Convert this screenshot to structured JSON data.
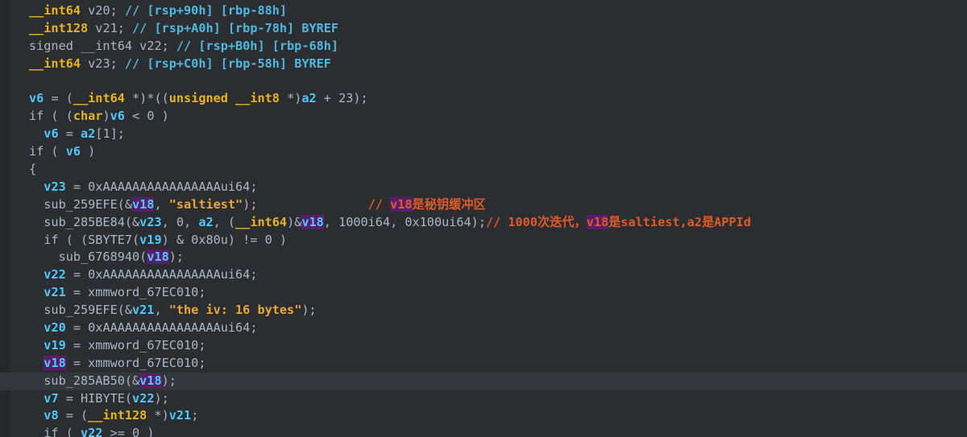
{
  "editor": {
    "lines": [
      {
        "segs": [
          {
            "t": "__int64",
            "c": "type"
          },
          {
            "t": " v20; ",
            "c": "plain"
          },
          {
            "t": "// [rsp+90h] [rbp-88h]",
            "c": "cmt"
          }
        ]
      },
      {
        "segs": [
          {
            "t": "__int128",
            "c": "type"
          },
          {
            "t": " v21; ",
            "c": "plain"
          },
          {
            "t": "// [rsp+A0h] [rbp-78h] BYREF",
            "c": "cmt"
          }
        ]
      },
      {
        "segs": [
          {
            "t": "signed __int64 v22; ",
            "c": "plain"
          },
          {
            "t": "// [rsp+B0h] [rbp-68h]",
            "c": "cmt"
          }
        ]
      },
      {
        "segs": [
          {
            "t": "__int64",
            "c": "type"
          },
          {
            "t": " v23; ",
            "c": "plain"
          },
          {
            "t": "// [rsp+C0h] [rbp-58h] BYREF",
            "c": "cmt"
          }
        ]
      },
      {
        "segs": []
      },
      {
        "segs": [
          {
            "t": "v6",
            "c": "var"
          },
          {
            "t": " = (",
            "c": "plain"
          },
          {
            "t": "__int64",
            "c": "type"
          },
          {
            "t": " *)*((",
            "c": "plain"
          },
          {
            "t": "unsigned __int8",
            "c": "type"
          },
          {
            "t": " *)",
            "c": "plain"
          },
          {
            "t": "a2",
            "c": "var"
          },
          {
            "t": " + 23);",
            "c": "plain"
          }
        ]
      },
      {
        "segs": [
          {
            "t": "if ( (",
            "c": "plain"
          },
          {
            "t": "char",
            "c": "type"
          },
          {
            "t": ")",
            "c": "plain"
          },
          {
            "t": "v6",
            "c": "var"
          },
          {
            "t": " < 0 )",
            "c": "plain"
          }
        ]
      },
      {
        "segs": [
          {
            "t": "  ",
            "c": "plain"
          },
          {
            "t": "v6",
            "c": "var"
          },
          {
            "t": " = ",
            "c": "plain"
          },
          {
            "t": "a2",
            "c": "var"
          },
          {
            "t": "[1];",
            "c": "plain"
          }
        ]
      },
      {
        "segs": [
          {
            "t": "if ( ",
            "c": "plain"
          },
          {
            "t": "v6",
            "c": "var"
          },
          {
            "t": " )",
            "c": "plain"
          }
        ]
      },
      {
        "segs": [
          {
            "t": "{",
            "c": "plain"
          }
        ]
      },
      {
        "segs": [
          {
            "t": "  ",
            "c": "plain"
          },
          {
            "t": "v23",
            "c": "var"
          },
          {
            "t": " = 0xAAAAAAAAAAAAAAAAui64;",
            "c": "plain"
          }
        ]
      },
      {
        "segs": [
          {
            "t": "  sub_259EFE(&",
            "c": "plain"
          },
          {
            "t": "v18",
            "c": "hlvar"
          },
          {
            "t": ", ",
            "c": "plain"
          },
          {
            "t": "\"saltiest\"",
            "c": "str"
          },
          {
            "t": ");               ",
            "c": "plain"
          },
          {
            "t": "// ",
            "c": "cmtz"
          },
          {
            "t": "v18",
            "c": "cmthl"
          },
          {
            "t": "是秘钥缓冲区",
            "c": "cmtz"
          }
        ]
      },
      {
        "segs": [
          {
            "t": "  sub_285BE84(&",
            "c": "plain"
          },
          {
            "t": "v23",
            "c": "var"
          },
          {
            "t": ", 0, ",
            "c": "plain"
          },
          {
            "t": "a2",
            "c": "var"
          },
          {
            "t": ", (",
            "c": "plain"
          },
          {
            "t": "__int64",
            "c": "type"
          },
          {
            "t": ")&",
            "c": "plain"
          },
          {
            "t": "v18",
            "c": "hlvar"
          },
          {
            "t": ", 1000i64, 0x100ui64);",
            "c": "plain"
          },
          {
            "t": "// 1000次迭代，",
            "c": "cmtz"
          },
          {
            "t": "v18",
            "c": "cmthl"
          },
          {
            "t": "是saltiest,a2是APPId",
            "c": "cmtz"
          }
        ]
      },
      {
        "segs": [
          {
            "t": "  if ( (SBYTE7(",
            "c": "plain"
          },
          {
            "t": "v19",
            "c": "var"
          },
          {
            "t": ") & 0x80u) != 0 )",
            "c": "plain"
          }
        ]
      },
      {
        "segs": [
          {
            "t": "    sub_6768940(",
            "c": "plain"
          },
          {
            "t": "v18",
            "c": "hlvar"
          },
          {
            "t": ");",
            "c": "plain"
          }
        ]
      },
      {
        "segs": [
          {
            "t": "  ",
            "c": "plain"
          },
          {
            "t": "v22",
            "c": "var"
          },
          {
            "t": " = 0xAAAAAAAAAAAAAAAAui64;",
            "c": "plain"
          }
        ]
      },
      {
        "segs": [
          {
            "t": "  ",
            "c": "plain"
          },
          {
            "t": "v21",
            "c": "var"
          },
          {
            "t": " = xmmword_67EC010;",
            "c": "plain"
          }
        ]
      },
      {
        "segs": [
          {
            "t": "  sub_259EFE(&",
            "c": "plain"
          },
          {
            "t": "v21",
            "c": "var"
          },
          {
            "t": ", ",
            "c": "plain"
          },
          {
            "t": "\"the iv: 16 bytes\"",
            "c": "str"
          },
          {
            "t": ");",
            "c": "plain"
          }
        ]
      },
      {
        "segs": [
          {
            "t": "  ",
            "c": "plain"
          },
          {
            "t": "v20",
            "c": "var"
          },
          {
            "t": " = 0xAAAAAAAAAAAAAAAAui64;",
            "c": "plain"
          }
        ]
      },
      {
        "segs": [
          {
            "t": "  ",
            "c": "plain"
          },
          {
            "t": "v19",
            "c": "var"
          },
          {
            "t": " = xmmword_67EC010;",
            "c": "plain"
          }
        ]
      },
      {
        "segs": [
          {
            "t": "  ",
            "c": "plain"
          },
          {
            "t": "v18",
            "c": "hlvar"
          },
          {
            "t": " = xmmword_67EC010;",
            "c": "plain"
          }
        ]
      },
      {
        "hl": true,
        "segs": [
          {
            "t": "  sub_285AB50(&",
            "c": "plain"
          },
          {
            "t": "v18",
            "c": "hlvar"
          },
          {
            "t": ");",
            "c": "plain"
          }
        ]
      },
      {
        "segs": [
          {
            "t": "  ",
            "c": "plain"
          },
          {
            "t": "v7",
            "c": "var"
          },
          {
            "t": " = HIBYTE(",
            "c": "plain"
          },
          {
            "t": "v22",
            "c": "var"
          },
          {
            "t": ");",
            "c": "plain"
          }
        ]
      },
      {
        "segs": [
          {
            "t": "  ",
            "c": "plain"
          },
          {
            "t": "v8",
            "c": "var"
          },
          {
            "t": " = (",
            "c": "plain"
          },
          {
            "t": "__int128",
            "c": "type"
          },
          {
            "t": " *)",
            "c": "plain"
          },
          {
            "t": "v21",
            "c": "var"
          },
          {
            "t": ";",
            "c": "plain"
          }
        ]
      },
      {
        "segs": [
          {
            "t": "  if ( ",
            "c": "plain"
          },
          {
            "t": "v22",
            "c": "var"
          },
          {
            "t": " >= 0 )",
            "c": "plain"
          }
        ]
      }
    ]
  }
}
